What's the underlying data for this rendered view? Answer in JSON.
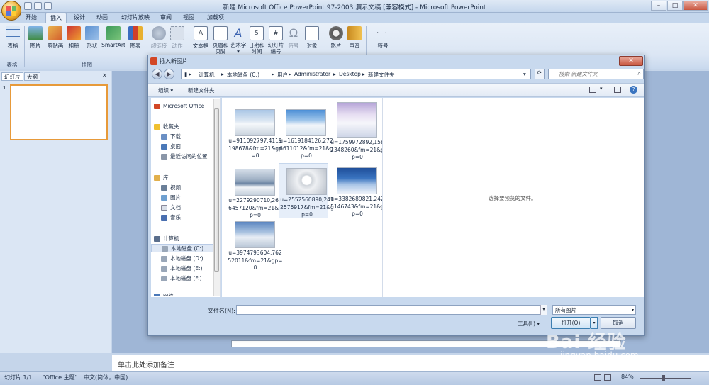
{
  "window": {
    "title": "新建 Microsoft Office PowerPoint 97-2003 演示文稿 [兼容模式] - Microsoft PowerPoint",
    "min": "–",
    "max": "□",
    "close": "✕"
  },
  "tabs": [
    "开始",
    "插入",
    "设计",
    "动画",
    "幻灯片放映",
    "审阅",
    "视图",
    "加载项"
  ],
  "ribbon": {
    "groups": [
      "表格",
      "插图"
    ],
    "buttons": {
      "table": "表格",
      "picture": "图片",
      "clipart": "剪贴画",
      "album": "相册",
      "shapes": "形状",
      "smartart": "SmartArt",
      "chart": "图表",
      "hyperlink": "超链接",
      "action": "动作",
      "textbox": "文本框",
      "header": "页眉和",
      "header2": "页脚",
      "wordart": "艺术字",
      "wordart2": "▾",
      "datetime": "日期和",
      "datetime2": "时间",
      "slidenum": "幻灯片",
      "slidenum2": "编号",
      "symbol": "符号",
      "object": "对象",
      "movie": "影片",
      "sound": "声音",
      "special": "符号"
    }
  },
  "left_panel": {
    "tab_slides": "幻灯片",
    "tab_outline": "大纲",
    "close": "✕",
    "slide_number": "1"
  },
  "dialog": {
    "title": "插入新图片",
    "close": "✕",
    "breadcrumb": [
      "计算机",
      "本地磁盘 (C:)",
      "用户",
      "Administrator",
      "Desktop",
      "新建文件夹"
    ],
    "search_placeholder": "搜索 新建文件夹",
    "toolbar": {
      "organize": "组织 ▾",
      "new_folder": "新建文件夹"
    },
    "nav": {
      "office": "Microsoft Office",
      "favorites": "收藏夹",
      "downloads": "下载",
      "desktop": "桌面",
      "recent": "最近访问的位置",
      "libraries": "库",
      "videos": "视频",
      "pictures": "图片",
      "documents": "文档",
      "music": "音乐",
      "computer": "计算机",
      "drive_c": "本地磁盘 (C:)",
      "drive_d": "本地磁盘 (D:)",
      "drive_e": "本地磁盘 (E:)",
      "drive_f": "本地磁盘 (F:)",
      "network": "网络"
    },
    "files": [
      "u=911092797,4119198678&fm=21&gp=0",
      "u=1619184126,2726611012&fm=21&gp=0",
      "u=1759972892,1582348260&fm=21&gp=0",
      "u=2279290710,2626457120&fm=21&gp=0",
      "u=2552560890,2412576917&fm=21&gp=0",
      "u=3382689821,2425146743&fm=21&gp=0",
      "u=3974793604,76252011&fm=21&gp=0"
    ],
    "preview_text": "选择要预览的文件。",
    "filename_label": "文件名(N):",
    "filename_value": "",
    "filetype": "所有图片",
    "tools": "工具(L) ▾",
    "open": "打开(O)",
    "cancel": "取消"
  },
  "notes_placeholder": "单击此处添加备注",
  "status": {
    "slide": "幻灯片 1/1",
    "theme": "\"Office 主题\"",
    "lang": "中文(简体，中国)",
    "zoom": "84%"
  },
  "watermark": {
    "main": "Bai 经验",
    "sub": "jingyan.baidu.com"
  }
}
